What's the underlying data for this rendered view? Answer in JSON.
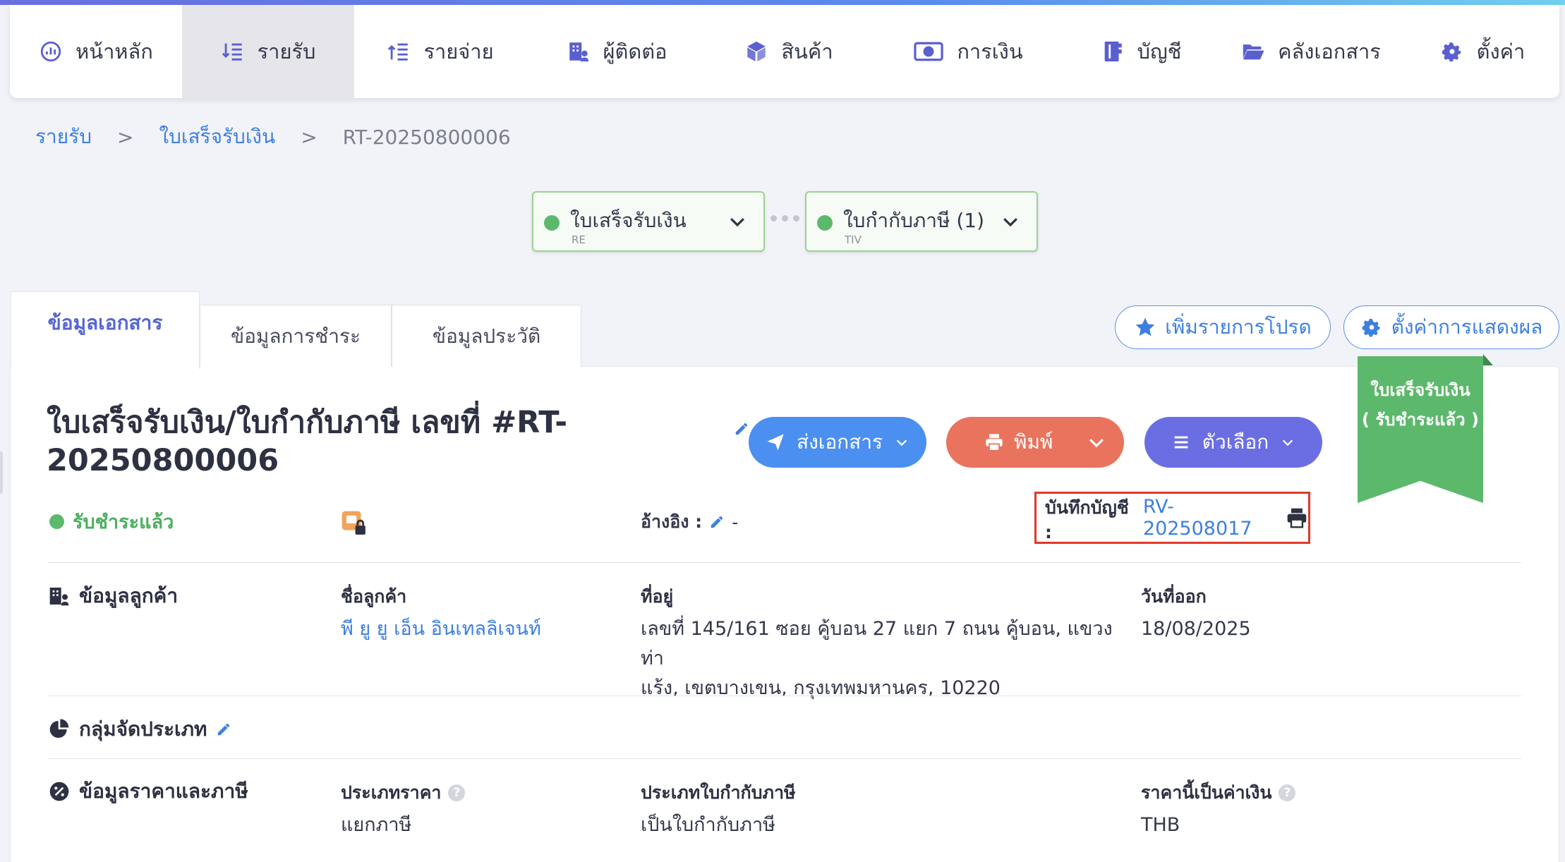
{
  "nav": {
    "items": [
      {
        "label": "หน้าหลัก",
        "icon": "dashboard-icon"
      },
      {
        "label": "รายรับ",
        "icon": "income-icon"
      },
      {
        "label": "รายจ่าย",
        "icon": "expense-icon"
      },
      {
        "label": "ผู้ติดต่อ",
        "icon": "contacts-icon"
      },
      {
        "label": "สินค้า",
        "icon": "product-box-icon"
      },
      {
        "label": "การเงิน",
        "icon": "money-icon"
      },
      {
        "label": "บัญชี",
        "icon": "ledger-icon"
      },
      {
        "label": "คลังเอกสาร",
        "icon": "folder-icon"
      },
      {
        "label": "ตั้งค่า",
        "icon": "gear-icon"
      }
    ],
    "active_index": 1
  },
  "breadcrumb": {
    "level1": "รายรับ",
    "level2": "ใบเสร็จรับเงิน",
    "current": "RT-20250800006",
    "separator": ">"
  },
  "flow": {
    "doc1": {
      "title": "ใบเสร็จรับเงิน",
      "code": "RE"
    },
    "doc2": {
      "title": "ใบกำกับภาษี (1)",
      "code": "TIV"
    }
  },
  "tabs": [
    "ข้อมูลเอกสาร",
    "ข้อมูลการชำระ",
    "ข้อมูลประวัติ"
  ],
  "toolbar": {
    "favorite_label": "เพิ่มรายการโปรด",
    "display_settings_label": "ตั้งค่าการแสดงผล"
  },
  "document": {
    "title_line1": "ใบเสร็จรับเงิน/ใบกำกับภาษี เลขที่ #RT-",
    "title_line2": "20250800006",
    "send_label": "ส่งเอกสาร",
    "print_label": "พิมพ์",
    "options_label": "ตัวเลือก",
    "ribbon_line1": "ใบเสร็จรับเงิน",
    "ribbon_line2": "( รับชำระแล้ว )",
    "status": "รับชำระแล้ว",
    "reference_label": "อ้างอิง :",
    "reference_value": "-",
    "journal_label": "บันทึกบัญชี :",
    "journal_value": "RV-202508017"
  },
  "customer": {
    "section_title": "ข้อมูลลูกค้า",
    "name_label": "ชื่อลูกค้า",
    "name_value": "พี ยู ยู เอ็น อินเทลลิเจนท์",
    "address_label": "ที่อยู่",
    "address_line1": "เลขที่ 145/161 ซอย คู้บอน 27 แยก 7 ถนน คู้บอน, แขวงท่า",
    "address_line2": "แร้ง, เขตบางเขน, กรุงเทพมหานคร, 10220",
    "issue_date_label": "วันที่ออก",
    "issue_date_value": "18/08/2025"
  },
  "category": {
    "section_title": "กลุ่มจัดประเภท"
  },
  "pricing": {
    "section_title": "ข้อมูลราคาและภาษี",
    "price_type_label": "ประเภทราคา",
    "price_type_value": "แยกภาษี",
    "tax_invoice_type_label": "ประเภทใบกำกับภาษี",
    "tax_invoice_type_value": "เป็นใบกำกับภาษี",
    "currency_label": "ราคานี้เป็นค่าเงิน",
    "currency_value": "THB"
  },
  "colors": {
    "accent_blue": "#3d7fe0",
    "send_button": "#4b8ff0",
    "print_button": "#e9735c",
    "options_button": "#6b6ee3",
    "paid_green": "#5cb96c",
    "highlight_red": "#e0392b"
  }
}
